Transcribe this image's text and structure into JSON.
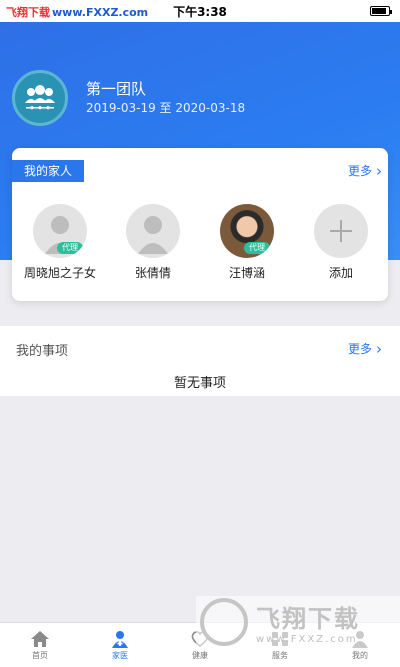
{
  "status_bar": {
    "time": "下午3:38"
  },
  "watermark": {
    "site_name": "飞翔下载",
    "domain": "www.FXXZ.com",
    "logo_title": "飞翔下载",
    "logo_url": "www.FXXZ.com"
  },
  "team": {
    "name": "第一团队",
    "period": "2019-03-19 至 2020-03-18",
    "icon": "team-group-icon"
  },
  "family": {
    "title": "我的家人",
    "more_label": "更多",
    "members": [
      {
        "name": "周晓旭之子女",
        "badge": "代理",
        "avatar": "default-person"
      },
      {
        "name": "张倩倩",
        "badge": "",
        "avatar": "default-person"
      },
      {
        "name": "汪博涵",
        "badge": "代理",
        "avatar": "photo"
      }
    ],
    "add_label": "添加"
  },
  "matters": {
    "title": "我的事项",
    "more_label": "更多",
    "empty_text": "暂无事项"
  },
  "tabbar": {
    "items": [
      {
        "label": "首页",
        "icon": "home-icon",
        "active": false
      },
      {
        "label": "家医",
        "icon": "doctor-icon",
        "active": true
      },
      {
        "label": "健康",
        "icon": "health-icon",
        "active": false
      },
      {
        "label": "服务",
        "icon": "service-icon",
        "active": false
      },
      {
        "label": "我的",
        "icon": "profile-icon",
        "active": false
      }
    ]
  },
  "colors": {
    "primary": "#2a76ec",
    "badge": "#2dbf9d",
    "header_start": "#2f6fe6",
    "header_end": "#3a8ef5"
  }
}
